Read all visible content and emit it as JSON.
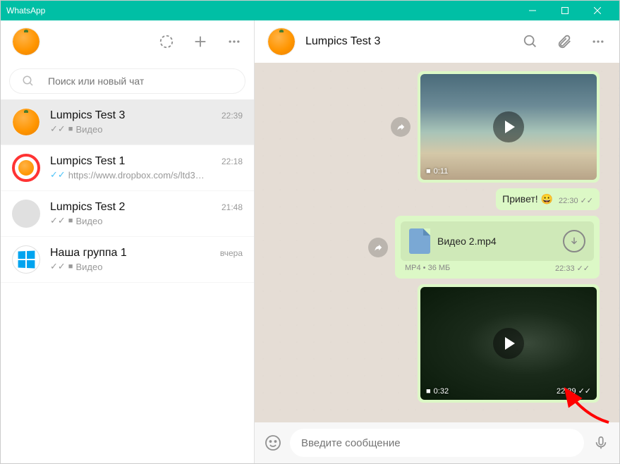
{
  "window": {
    "title": "WhatsApp"
  },
  "left_header": {
    "avatar_type": "orange"
  },
  "search": {
    "placeholder": "Поиск или новый чат"
  },
  "chats": [
    {
      "name": "Lumpics Test 3",
      "time": "22:39",
      "tick": "grey",
      "icon": "video",
      "preview": "Видео",
      "avatar": "orange",
      "active": true
    },
    {
      "name": "Lumpics Test 1",
      "time": "22:18",
      "tick": "blue",
      "icon": "",
      "preview": "https://www.dropbox.com/s/ltd3…",
      "avatar": "logo",
      "active": false
    },
    {
      "name": "Lumpics Test 2",
      "time": "21:48",
      "tick": "grey",
      "icon": "video",
      "preview": "Видео",
      "avatar": "grey",
      "active": false
    },
    {
      "name": "Наша группа 1",
      "time": "вчера",
      "tick": "grey",
      "icon": "video",
      "preview": "Видео",
      "avatar": "win",
      "active": false
    }
  ],
  "conversation": {
    "title": "Lumpics Test 3",
    "messages": {
      "video1": {
        "duration": "0:11",
        "time": ""
      },
      "text1": {
        "body": "Привет! 😀",
        "time": "22:30"
      },
      "file1": {
        "name": "Видео 2.mp4",
        "meta": "MP4 • 36 МБ",
        "time": "22:33"
      },
      "video2": {
        "duration": "0:32",
        "time": "22:39"
      }
    }
  },
  "composer": {
    "placeholder": "Введите сообщение"
  },
  "ticks": {
    "double": "✓✓"
  }
}
